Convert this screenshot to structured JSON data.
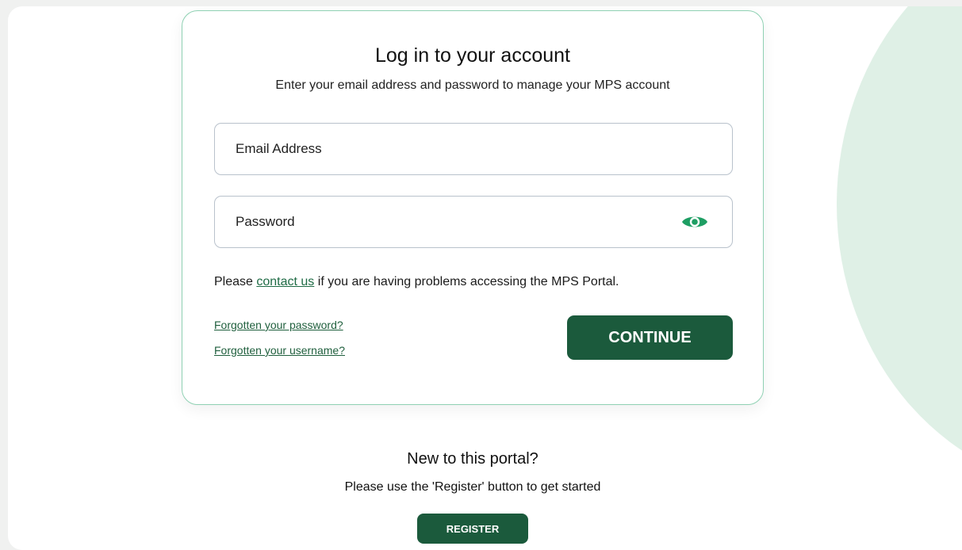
{
  "login": {
    "title": "Log in to your account",
    "subtitle": "Enter your email address and password to manage your MPS account",
    "email_placeholder": "Email Address",
    "password_placeholder": "Password",
    "password_toggle_icon": "eye-icon",
    "help_prefix": "Please ",
    "help_link": "contact us",
    "help_suffix": " if you are having problems accessing the MPS Portal.",
    "forgot_password": "Forgotten your password?",
    "forgot_username": "Forgotten your username?",
    "continue_label": "CONTINUE"
  },
  "register": {
    "title": "New to this portal?",
    "subtitle": "Please use the 'Register' button to get started",
    "button_label": "REGISTER"
  },
  "colors": {
    "brand_green": "#1b5a3c",
    "card_border": "#8fd1b3",
    "eye_icon": "#1e9e63",
    "background_circle": "#dff0e6"
  }
}
